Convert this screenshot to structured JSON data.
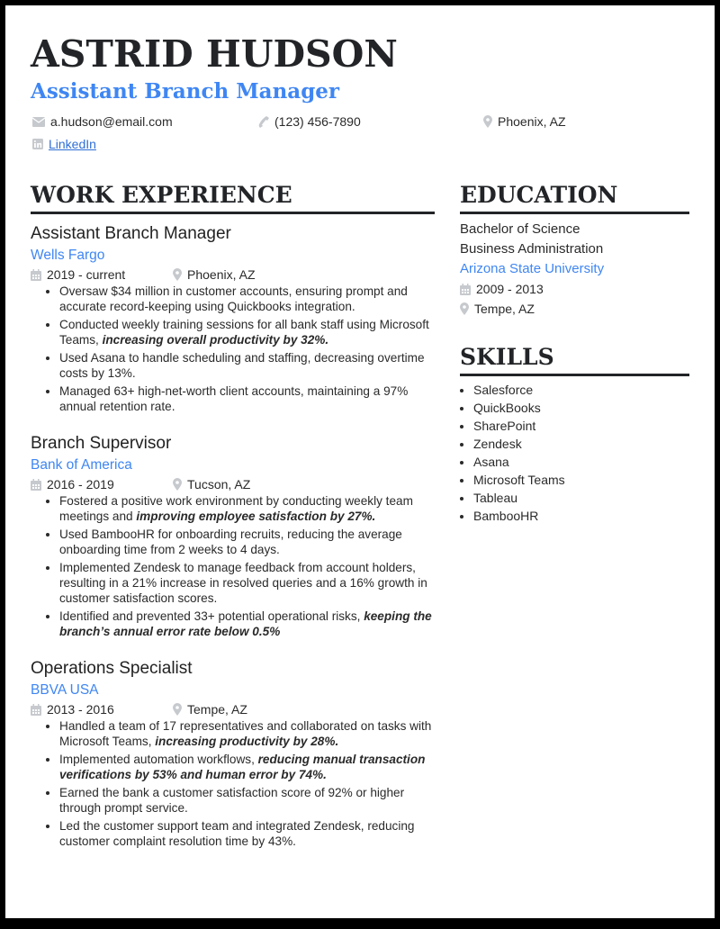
{
  "header": {
    "name": "ASTRID HUDSON",
    "title": "Assistant Branch Manager",
    "contacts": [
      {
        "icon": "envelope-icon",
        "text": "a.hudson@email.com"
      },
      {
        "icon": "phone-icon",
        "text": "(123) 456-7890"
      },
      {
        "icon": "map-pin-icon",
        "text": "Phoenix, AZ"
      },
      {
        "icon": "linkedin-icon",
        "text": "LinkedIn"
      }
    ]
  },
  "colors": {
    "accent": "#3f86f2",
    "heading": "#222427",
    "icon": "#c6c9cd",
    "frame": "#000000"
  },
  "work": {
    "heading": "WORK EXPERIENCE",
    "jobs": [
      {
        "title": "Assistant Branch Manager",
        "company": "Wells Fargo",
        "dates": "2019 - current",
        "location": "Phoenix, AZ",
        "bullets": [
          {
            "text": "Oversaw $34 million in customer accounts, ensuring prompt and accurate record-keeping using Quickbooks integration.",
            "emph": ""
          },
          {
            "text": "Conducted weekly training sessions for all bank staff using Microsoft Teams, ",
            "emph": "increasing overall productivity by 32%."
          },
          {
            "text": "Used Asana to handle scheduling and staffing, decreasing overtime costs by 13%.",
            "emph": ""
          },
          {
            "text": "Managed 63+ high-net-worth client accounts, maintaining a 97% annual retention rate.",
            "emph": ""
          }
        ]
      },
      {
        "title": "Branch Supervisor",
        "company": "Bank of America",
        "dates": "2016 - 2019",
        "location": "Tucson, AZ",
        "bullets": [
          {
            "text": "Fostered a positive work environment by conducting weekly team meetings and ",
            "emph": "improving employee satisfaction by 27%."
          },
          {
            "text": "Used BambooHR for onboarding recruits, reducing the average onboarding time from 2 weeks to 4 days.",
            "emph": ""
          },
          {
            "text": "Implemented Zendesk to manage feedback from account holders, resulting in a 21% increase in resolved queries and a 16% growth in customer satisfaction scores.",
            "emph": ""
          },
          {
            "text": "Identified and prevented 33+ potential operational risks, ",
            "emph": "keeping the branch’s annual error rate below 0.5%"
          }
        ]
      },
      {
        "title": "Operations Specialist",
        "company": "BBVA USA",
        "dates": "2013 - 2016",
        "location": "Tempe, AZ",
        "bullets": [
          {
            "text": "Handled a team of 17 representatives and collaborated on tasks with Microsoft Teams, ",
            "emph": "increasing productivity by 28%."
          },
          {
            "text": "Implemented automation workflows, ",
            "emph": "reducing manual transaction verifications by 53% and human error by 74%."
          },
          {
            "text": "Earned the bank a customer satisfaction score of 92% or higher through prompt service.",
            "emph": ""
          },
          {
            "text": "Led the customer support team and integrated Zendesk, reducing customer complaint resolution time by 43%.",
            "emph": ""
          }
        ]
      }
    ]
  },
  "education": {
    "heading": "EDUCATION",
    "degree": "Bachelor of Science",
    "field": "Business Administration",
    "school": "Arizona State University",
    "dates": "2009 - 2013",
    "location": "Tempe, AZ"
  },
  "skills": {
    "heading": "SKILLS",
    "items": [
      "Salesforce",
      "QuickBooks",
      "SharePoint",
      "Zendesk",
      "Asana",
      "Microsoft Teams",
      "Tableau",
      "BambooHR"
    ]
  }
}
